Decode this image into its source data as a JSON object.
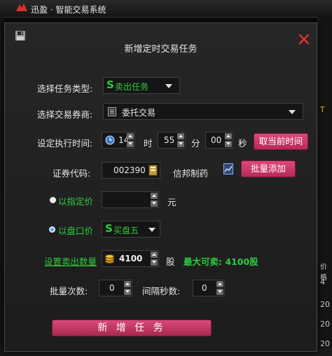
{
  "app": {
    "title": "迅盈 · 智能交易系统"
  },
  "background": {
    "right_labels": [
      "T",
      "价格",
      "4",
      "20",
      "20",
      "20"
    ]
  },
  "dialog": {
    "title": "新增定时交易任务",
    "task_type": {
      "label": "选择任务类型:",
      "value": "卖出任务"
    },
    "broker": {
      "label": "选择交易券商:",
      "value": "委托交易"
    },
    "exec_time": {
      "label": "设定执行时间:",
      "hour": "14",
      "hour_unit": "时",
      "minute": "55",
      "minute_unit": "分",
      "second": "00",
      "second_unit": "秒",
      "now_button": "取当前时间"
    },
    "stock": {
      "label": "证券代码:",
      "code": "002390",
      "name": "信邦制药",
      "batch_button": "批量添加"
    },
    "fixed_price": {
      "label": "以指定价",
      "value": "",
      "unit": "元"
    },
    "market_price": {
      "label": "以盘口价",
      "value": "买盘五"
    },
    "sell_qty": {
      "label": "设置卖出数量",
      "value": "4100",
      "unit": "股",
      "max_text": "最大可卖: 4100股"
    },
    "batch": {
      "count_label": "批量次数:",
      "count": "0",
      "interval_label": "间隔秒数:",
      "interval": "0"
    },
    "submit_button": "新 增 任 务"
  },
  "colors": {
    "accent": "#c8336a",
    "green": "#2ecc40",
    "radio_on": "#5aa0e8"
  }
}
